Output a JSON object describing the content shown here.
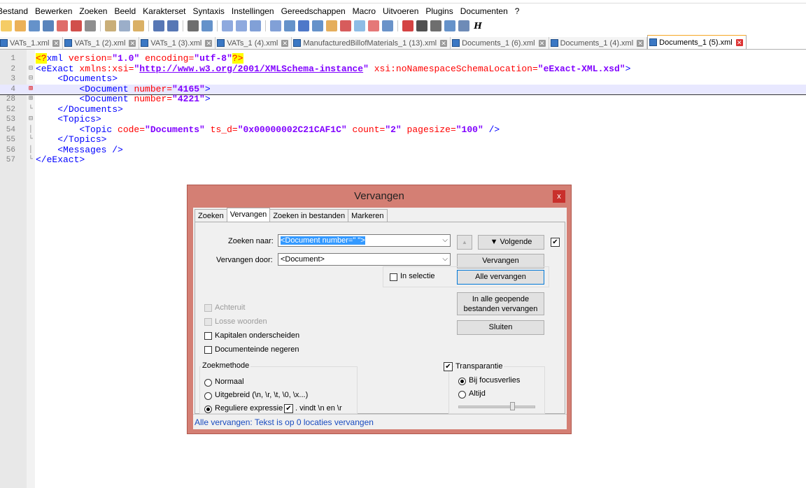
{
  "menu": [
    "Bestand",
    "Bewerken",
    "Zoeken",
    "Beeld",
    "Karakterset",
    "Syntaxis",
    "Instellingen",
    "Gereedschappen",
    "Macro",
    "Uitvoeren",
    "Plugins",
    "Documenten",
    "?"
  ],
  "toolbar_icons": [
    "new-icon",
    "open-icon",
    "save-icon",
    "save-all-icon",
    "close-icon",
    "close-all-icon",
    "print-icon",
    "cut-icon",
    "copy-icon",
    "paste-icon",
    "undo-icon",
    "redo-icon",
    "find-icon",
    "replace-icon",
    "zoom-in-icon",
    "zoom-out-icon",
    "sync-v-icon",
    "sync-h-icon",
    "wrap-icon",
    "all-chars-icon",
    "indent-guide-icon",
    "udl-icon",
    "doc-map-icon",
    "function-list-icon",
    "folder-workspace-icon",
    "monitor-icon",
    "record-macro-icon",
    "stop-macro-icon",
    "play-macro-icon",
    "run-macro-multi-icon",
    "save-macro-icon",
    "h-icon"
  ],
  "tabs": [
    {
      "label": "VATs_1.xml",
      "active": false
    },
    {
      "label": "VATs_1 (2).xml",
      "active": false
    },
    {
      "label": "VATs_1 (3).xml",
      "active": false
    },
    {
      "label": "VATs_1 (4).xml",
      "active": false
    },
    {
      "label": "ManufacturedBillofMaterials_1 (13).xml",
      "active": false
    },
    {
      "label": "Documents_1 (6).xml",
      "active": false
    },
    {
      "label": "Documents_1 (4).xml",
      "active": false
    },
    {
      "label": "Documents_1 (5).xml",
      "active": true
    }
  ],
  "lines": [
    {
      "n": "1",
      "fold": "",
      "indent": 0,
      "parts": [
        [
          "pi",
          "<?"
        ],
        [
          "tag",
          "xml "
        ],
        [
          "attr",
          "version="
        ],
        [
          "val",
          "\"1.0\""
        ],
        [
          "attr",
          " encoding="
        ],
        [
          "val",
          "\"utf-8\""
        ],
        [
          "pi",
          "?>"
        ]
      ]
    },
    {
      "n": "2",
      "fold": "⊟",
      "indent": 0,
      "parts": [
        [
          "tag",
          "<eExact "
        ],
        [
          "attr",
          "xmlns:xsi="
        ],
        [
          "val",
          "\""
        ],
        [
          "url",
          "http://www.w3.org/2001/XMLSchema-instance"
        ],
        [
          "val",
          "\""
        ],
        [
          "attr",
          " xsi:noNamespaceSchemaLocation="
        ],
        [
          "val",
          "\"eExact-XML.xsd\""
        ],
        [
          "tag",
          ">"
        ]
      ]
    },
    {
      "n": "3",
      "fold": "⊟",
      "indent": 1,
      "parts": [
        [
          "tag",
          "<Documents>"
        ]
      ]
    },
    {
      "n": "4",
      "fold": "⊞",
      "indent": 2,
      "hl": true,
      "parts": [
        [
          "tag",
          "<Document "
        ],
        [
          "attr",
          "number="
        ],
        [
          "val",
          "\"4165\""
        ],
        [
          "tag",
          ">"
        ]
      ]
    },
    {
      "n": "28",
      "fold": "⊞",
      "indent": 2,
      "parts": [
        [
          "tag",
          "<Document "
        ],
        [
          "attr",
          "number="
        ],
        [
          "val",
          "\"4221\""
        ],
        [
          "tag",
          ">"
        ]
      ]
    },
    {
      "n": "52",
      "fold": "└",
      "indent": 1,
      "parts": [
        [
          "tag",
          "</Documents>"
        ]
      ]
    },
    {
      "n": "53",
      "fold": "⊟",
      "indent": 1,
      "parts": [
        [
          "tag",
          "<Topics>"
        ]
      ]
    },
    {
      "n": "54",
      "fold": "│",
      "indent": 2,
      "parts": [
        [
          "tag",
          "<Topic "
        ],
        [
          "attr",
          "code="
        ],
        [
          "val",
          "\"Documents\""
        ],
        [
          "attr",
          " ts_d="
        ],
        [
          "val",
          "\"0x00000002C21CAF1C\""
        ],
        [
          "attr",
          " count="
        ],
        [
          "val",
          "\"2\""
        ],
        [
          "attr",
          " pagesize="
        ],
        [
          "val",
          "\"100\""
        ],
        [
          "tag",
          " />"
        ]
      ]
    },
    {
      "n": "55",
      "fold": "└",
      "indent": 1,
      "parts": [
        [
          "tag",
          "</Topics>"
        ]
      ]
    },
    {
      "n": "56",
      "fold": "│",
      "indent": 1,
      "parts": [
        [
          "tag",
          "<Messages />"
        ]
      ]
    },
    {
      "n": "57",
      "fold": "└",
      "indent": 0,
      "parts": [
        [
          "tag",
          "</eExact>"
        ]
      ]
    }
  ],
  "dialog": {
    "title": "Vervangen",
    "close": "x",
    "tabs": [
      "Zoeken",
      "Vervangen",
      "Zoeken in bestanden",
      "Markeren"
    ],
    "find_label": "Zoeken naar:",
    "find_value": "<Document number=\" \">",
    "replace_label": "Vervangen door:",
    "replace_value": "<Document>",
    "up_arrow": "▲",
    "next_button": "▼ Volgende",
    "replace_button": "Vervangen",
    "replace_all_button": "Alle vervangen",
    "replace_all_open_button": "In alle geopende bestanden vervangen",
    "close_button": "Sluiten",
    "in_selection": "In selectie",
    "backward": "Achteruit",
    "whole_words": "Losse woorden",
    "match_case": "Kapitalen onderscheiden",
    "wrap_around": "Documenteinde negeren",
    "search_mode_title": "Zoekmethode",
    "mode_normal": "Normaal",
    "mode_extended": "Uitgebreid (\\n, \\r, \\t, \\0, \\x...)",
    "mode_regex": "Reguliere expressie",
    "dot_newline": ". vindt \\n en \\r",
    "transparency": "Transparantie",
    "on_focus_lost": "Bij focusverlies",
    "always": "Altijd",
    "status": "Alle vervangen: Tekst is op 0 locaties vervangen"
  },
  "colors": {
    "dialog_border": "#d47f74",
    "status_text": "#1a4cc0",
    "highlight_line": "#e8e8ff"
  }
}
